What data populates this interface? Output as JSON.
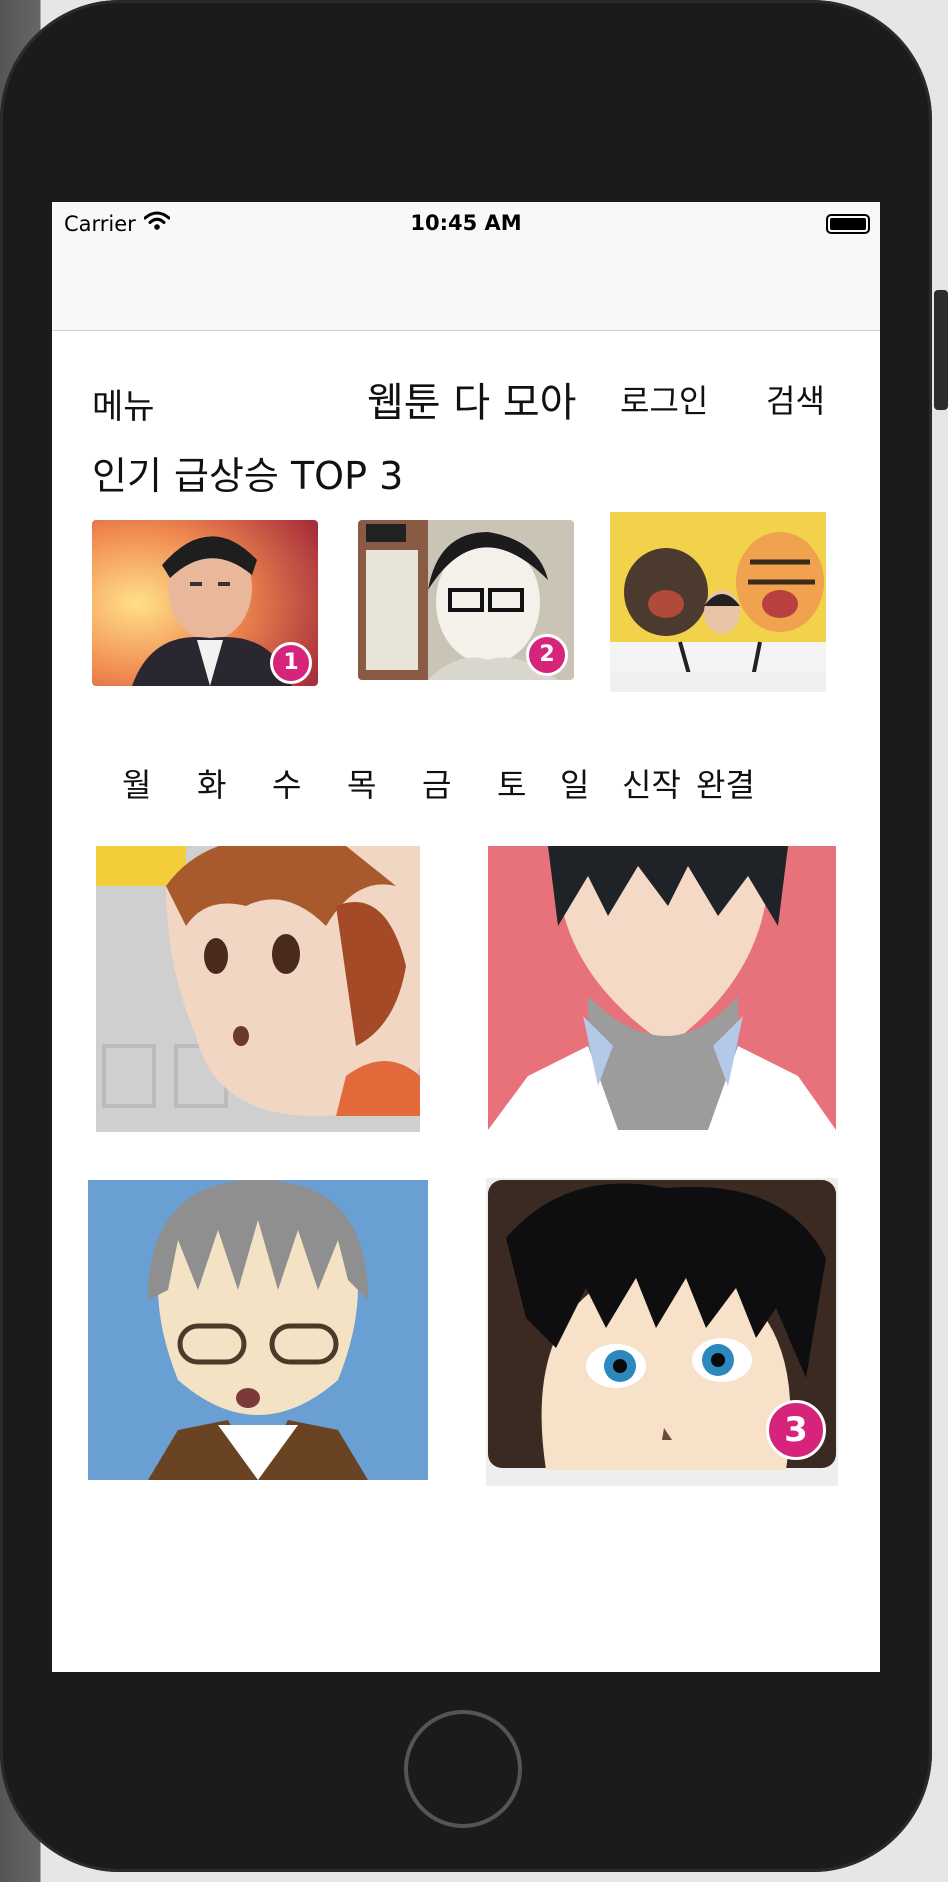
{
  "status_bar": {
    "carrier": "Carrier",
    "time": "10:45 AM"
  },
  "header": {
    "menu_label": "메뉴",
    "title": "웹툰 다 모아",
    "login_label": "로그인",
    "search_label": "검색"
  },
  "popular": {
    "section_title": "인기 급상승 TOP 3",
    "items": [
      {
        "rank": "1",
        "icon": "webtoon-thumbnail"
      },
      {
        "rank": "2",
        "icon": "webtoon-thumbnail"
      },
      {
        "rank": "",
        "icon": "webtoon-thumbnail"
      }
    ]
  },
  "day_tabs": [
    "월",
    "화",
    "수",
    "목",
    "금",
    "토",
    "일",
    "신작",
    "완결"
  ],
  "grid": {
    "items": [
      {
        "rank": "",
        "icon": "webtoon-thumbnail"
      },
      {
        "rank": "",
        "icon": "webtoon-thumbnail"
      },
      {
        "rank": "",
        "icon": "webtoon-thumbnail"
      },
      {
        "rank": "3",
        "icon": "webtoon-thumbnail"
      }
    ]
  },
  "colors": {
    "badge": "#d6247b",
    "phone_body": "#1b1b1c",
    "nav_background": "#f8f8f8"
  }
}
